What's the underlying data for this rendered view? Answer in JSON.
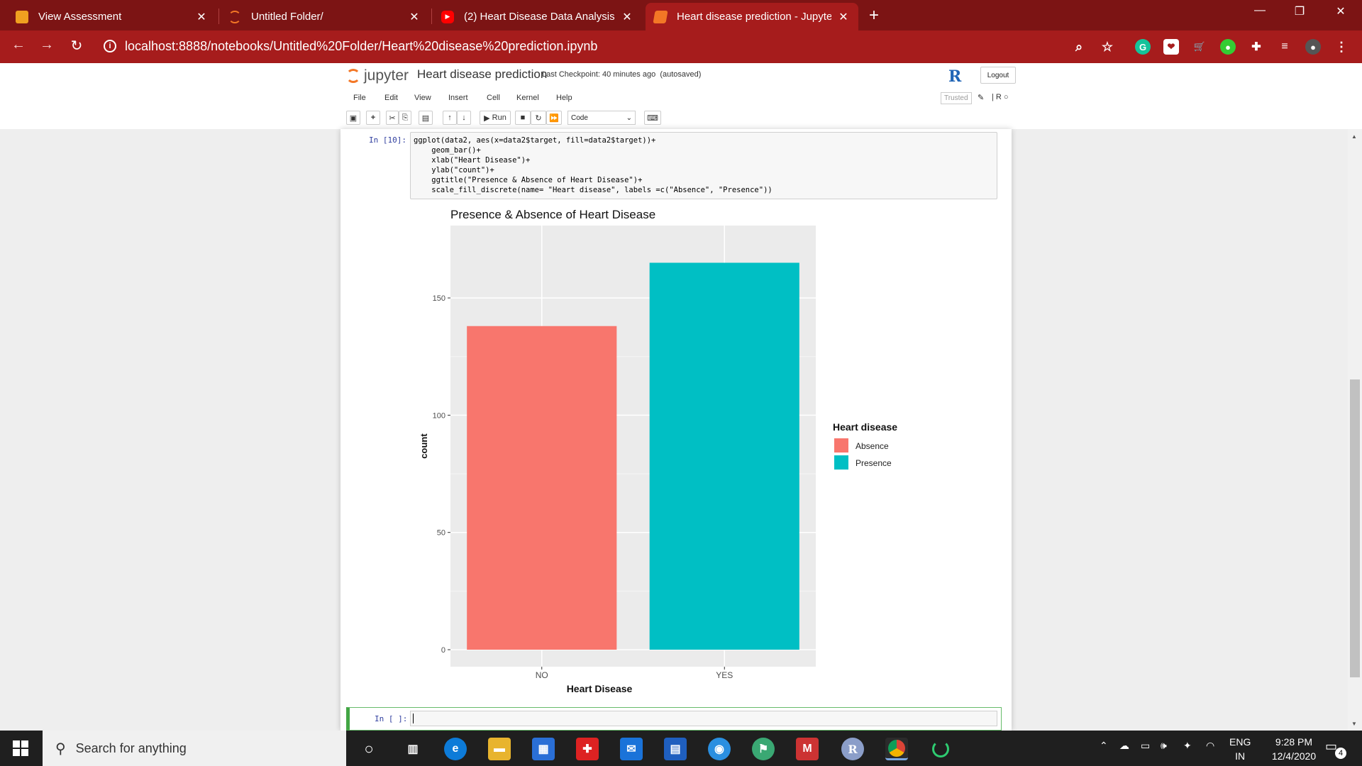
{
  "browser": {
    "tabs": [
      {
        "label": "View Assessment",
        "favicon": "pencil-icon",
        "color": "#f0a020"
      },
      {
        "label": "Untitled Folder/",
        "favicon": "jupyter-icon",
        "color": "#f37726"
      },
      {
        "label": "(2) Heart Disease Data Analysis w",
        "favicon": "youtube-icon",
        "color": "#ff0000"
      },
      {
        "label": "Heart disease prediction - Jupyte",
        "favicon": "jupyter-icon",
        "color": "#f37726"
      }
    ],
    "url": "localhost:8888/notebooks/Untitled%20Folder/Heart%20disease%20prediction.ipynb"
  },
  "jupyter": {
    "logo_text": "jupyter",
    "notebook_name": "Heart disease prediction",
    "checkpoint": "Last Checkpoint: 40 minutes ago",
    "autosaved": "(autosaved)",
    "logout_label": "Logout",
    "r_logo": "R",
    "menu": [
      "File",
      "Edit",
      "View",
      "Insert",
      "Cell",
      "Kernel",
      "Help"
    ],
    "trusted_label": "Trusted",
    "kernel_indicator": "R",
    "run_label": "Run",
    "cell_type": "Code"
  },
  "cell1": {
    "prompt": "In [10]:",
    "code_lines": [
      "ggplot(data2, aes(x=data2$target, fill=data2$target))+",
      "    geom_bar()+",
      "    xlab(\"Heart Disease\")+",
      "    ylab(\"count\")+",
      "    ggtitle(\"Presence & Absence of Heart Disease\")+",
      "    scale_fill_discrete(name= \"Heart disease\", labels =c(\"Absence\", \"Presence\"))"
    ]
  },
  "cell2": {
    "prompt": "In [ ]:"
  },
  "chart_data": {
    "type": "bar",
    "title": "Presence & Absence of Heart Disease",
    "xlabel": "Heart Disease",
    "ylabel": "count",
    "categories": [
      "NO",
      "YES"
    ],
    "values": [
      138,
      165
    ],
    "colors": [
      "#f8766d",
      "#00bfc4"
    ],
    "ylim": [
      0,
      175
    ],
    "yticks": [
      0,
      50,
      100,
      150
    ],
    "legend": {
      "title": "Heart disease",
      "entries": [
        "Absence",
        "Presence"
      ],
      "position": "right"
    },
    "grid": true
  },
  "taskbar": {
    "search_placeholder": "Search for anything",
    "lang_top": "ENG",
    "lang_bottom": "IN",
    "time": "9:28 PM",
    "date": "12/4/2020",
    "notification_count": "4"
  }
}
